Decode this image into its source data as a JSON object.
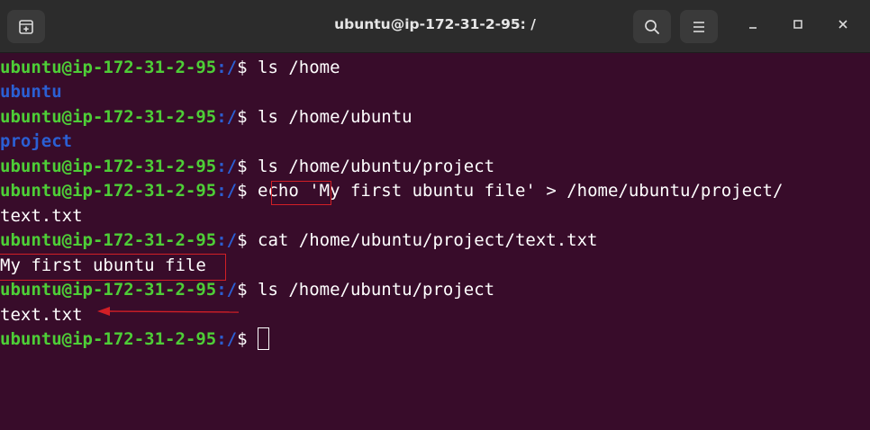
{
  "window": {
    "title": "ubuntu@ip-172-31-2-95: /"
  },
  "titlebar": {
    "new_tab_icon": "new-tab-icon",
    "search_icon": "search-icon",
    "menu_icon": "hamburger-menu-icon",
    "minimize_icon": "minimize-icon",
    "maximize_icon": "maximize-icon",
    "close_icon": "close-icon"
  },
  "terminal": {
    "prompt_user": "ubuntu@ip-172-31-2-95",
    "prompt_path": ":/",
    "prompt_symbol": "$",
    "lines": [
      {
        "kind": "cmd",
        "text": " ls /home"
      },
      {
        "kind": "dir",
        "text": "ubuntu"
      },
      {
        "kind": "cmd",
        "text": " ls /home/ubuntu"
      },
      {
        "kind": "dir",
        "text": "project"
      },
      {
        "kind": "cmd",
        "text": " ls /home/ubuntu/project"
      },
      {
        "kind": "cmd_echo",
        "cmd_word": "echo",
        "rest": " 'My first ubuntu file' > /home/ubuntu/project/"
      },
      {
        "kind": "out",
        "text": "text.txt"
      },
      {
        "kind": "cmd",
        "text": " cat /home/ubuntu/project/text.txt"
      },
      {
        "kind": "out",
        "text": "My first ubuntu file"
      },
      {
        "kind": "cmd",
        "text": " ls /home/ubuntu/project"
      },
      {
        "kind": "out",
        "text": "text.txt"
      },
      {
        "kind": "prompt_cursor"
      }
    ]
  },
  "colors": {
    "background": "#380c2a",
    "prompt_user": "#4ece37",
    "prompt_path": "#2b5fd3",
    "directory": "#2b5fd3",
    "annotation": "#d21f26",
    "titlebar": "#2c2c2c"
  }
}
